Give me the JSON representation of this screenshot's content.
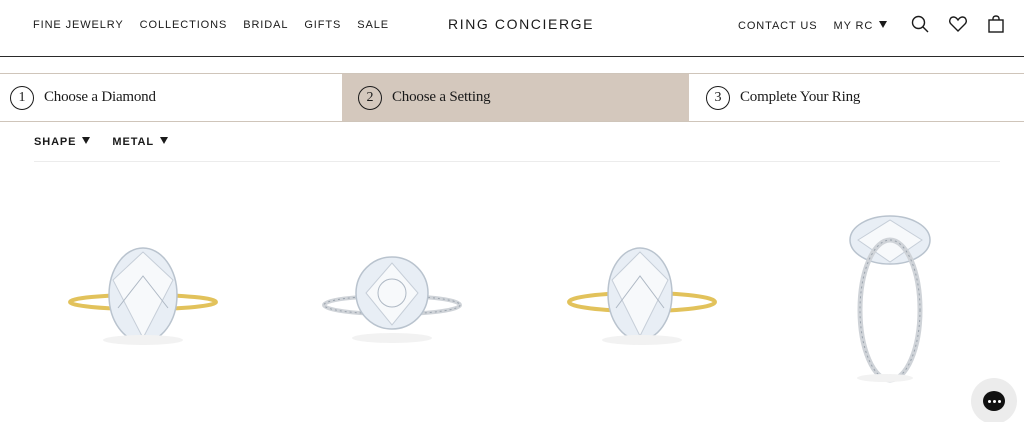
{
  "header": {
    "nav_left": [
      "FINE JEWELRY",
      "COLLECTIONS",
      "BRIDAL",
      "GIFTS",
      "SALE"
    ],
    "logo": "RING CONCIERGE",
    "contact": "CONTACT US",
    "my_rc": "MY RC",
    "icons": [
      "search-icon",
      "heart-icon",
      "bag-icon"
    ]
  },
  "steps": [
    {
      "num": "1",
      "label": "Choose a Diamond"
    },
    {
      "num": "2",
      "label": "Choose a Setting",
      "active": true
    },
    {
      "num": "3",
      "label": "Complete Your Ring"
    }
  ],
  "filters": {
    "shape": "SHAPE",
    "metal": "METAL"
  },
  "products": [
    {
      "name": "oval-solitaire-yellow-gold",
      "metal_color": "#e2c25b"
    },
    {
      "name": "round-pave-white-gold",
      "metal_color": "#cfd3d8"
    },
    {
      "name": "oval-solitaire-yellow-gold",
      "metal_color": "#e2c25b"
    },
    {
      "name": "oval-hidden-halo-white-gold",
      "metal_color": "#cfd3d8"
    }
  ],
  "colors": {
    "active_step_bg": "#d4c8bd",
    "border": "#cfc5ba",
    "text": "#1a1a1a"
  }
}
